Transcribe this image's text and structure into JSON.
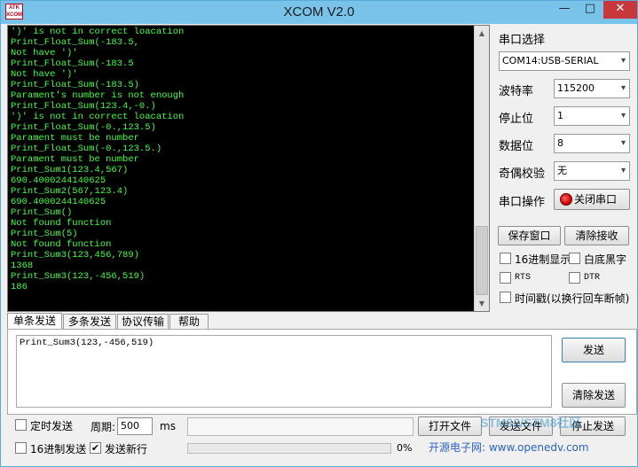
{
  "window": {
    "title": "XCOM V2.0",
    "logo_text": "ATK XCOM",
    "minimize": "—",
    "maximize": "□",
    "close": "✕"
  },
  "terminal": {
    "lines": [
      "')' is not in correct loacation",
      "Print_Float_Sum(-183.5,",
      "Not have ')'",
      "Print_Float_Sum(-183.5",
      "Not have ')'",
      "Print_Float_Sum(-183.5)",
      "Parament's number is not enough",
      "Print_Float_Sum(123.4,-0.)",
      "')' is not in correct loacation",
      "Print_Float_Sum(-0.,123.5)",
      "Parament must be number",
      "Print_Float_Sum(-0.,123.5.)",
      "Parament must be number",
      "Print_Sum1(123.4,567)",
      "690.4000244140625",
      "Print_Sum2(567,123.4)",
      "690.4000244140625",
      "Print_Sum()",
      "Not found function",
      "Print_Sum(5)",
      "Not found function",
      "Print_Sum3(123,456,789)",
      "1368",
      "Print_Sum3(123,-456,519)",
      "186"
    ]
  },
  "settings": {
    "port_label": "串口选择",
    "port_value": "COM14:USB-SERIAL",
    "baud_label": "波特率",
    "baud_value": "115200",
    "stop_label": "停止位",
    "stop_value": "1",
    "data_label": "数据位",
    "data_value": "8",
    "parity_label": "奇偶校验",
    "parity_value": "无",
    "op_label": "串口操作",
    "close_port_button": "关闭串口",
    "save_window_button": "保存窗口",
    "clear_receive_button": "清除接收",
    "hex_display": "16进制显示",
    "white_bg": "白底黑字",
    "rts": "RTS",
    "dtr": "DTR",
    "timestamp": "时间戳(以换行回车断帧)"
  },
  "tabs": [
    "单条发送",
    "多条发送",
    "协议传输",
    "帮助"
  ],
  "send": {
    "input_value": "Print_Sum3(123,-456,519)",
    "send_button": "发送",
    "clear_send_button": "清除发送"
  },
  "bottom": {
    "timed_send": "定时发送",
    "period_label": "周期:",
    "period_value": "500",
    "period_unit": "ms",
    "hex_send": "16进制发送",
    "send_newline": "发送新行",
    "newline_checked": "✔",
    "open_file_button": "打开文件",
    "send_file_button": "发送文件",
    "stop_send_button": "停止发送",
    "progress_percent": "0%",
    "progress_value": 0,
    "footer": "开源电子网: www.openedv.com",
    "watermark": "STM32/STM8社区"
  },
  "colors": {
    "terminal_text": "#3dff3d",
    "terminal_bg": "#000000",
    "titlebar": "#79c3ea",
    "close_btn": "#c7383c"
  }
}
